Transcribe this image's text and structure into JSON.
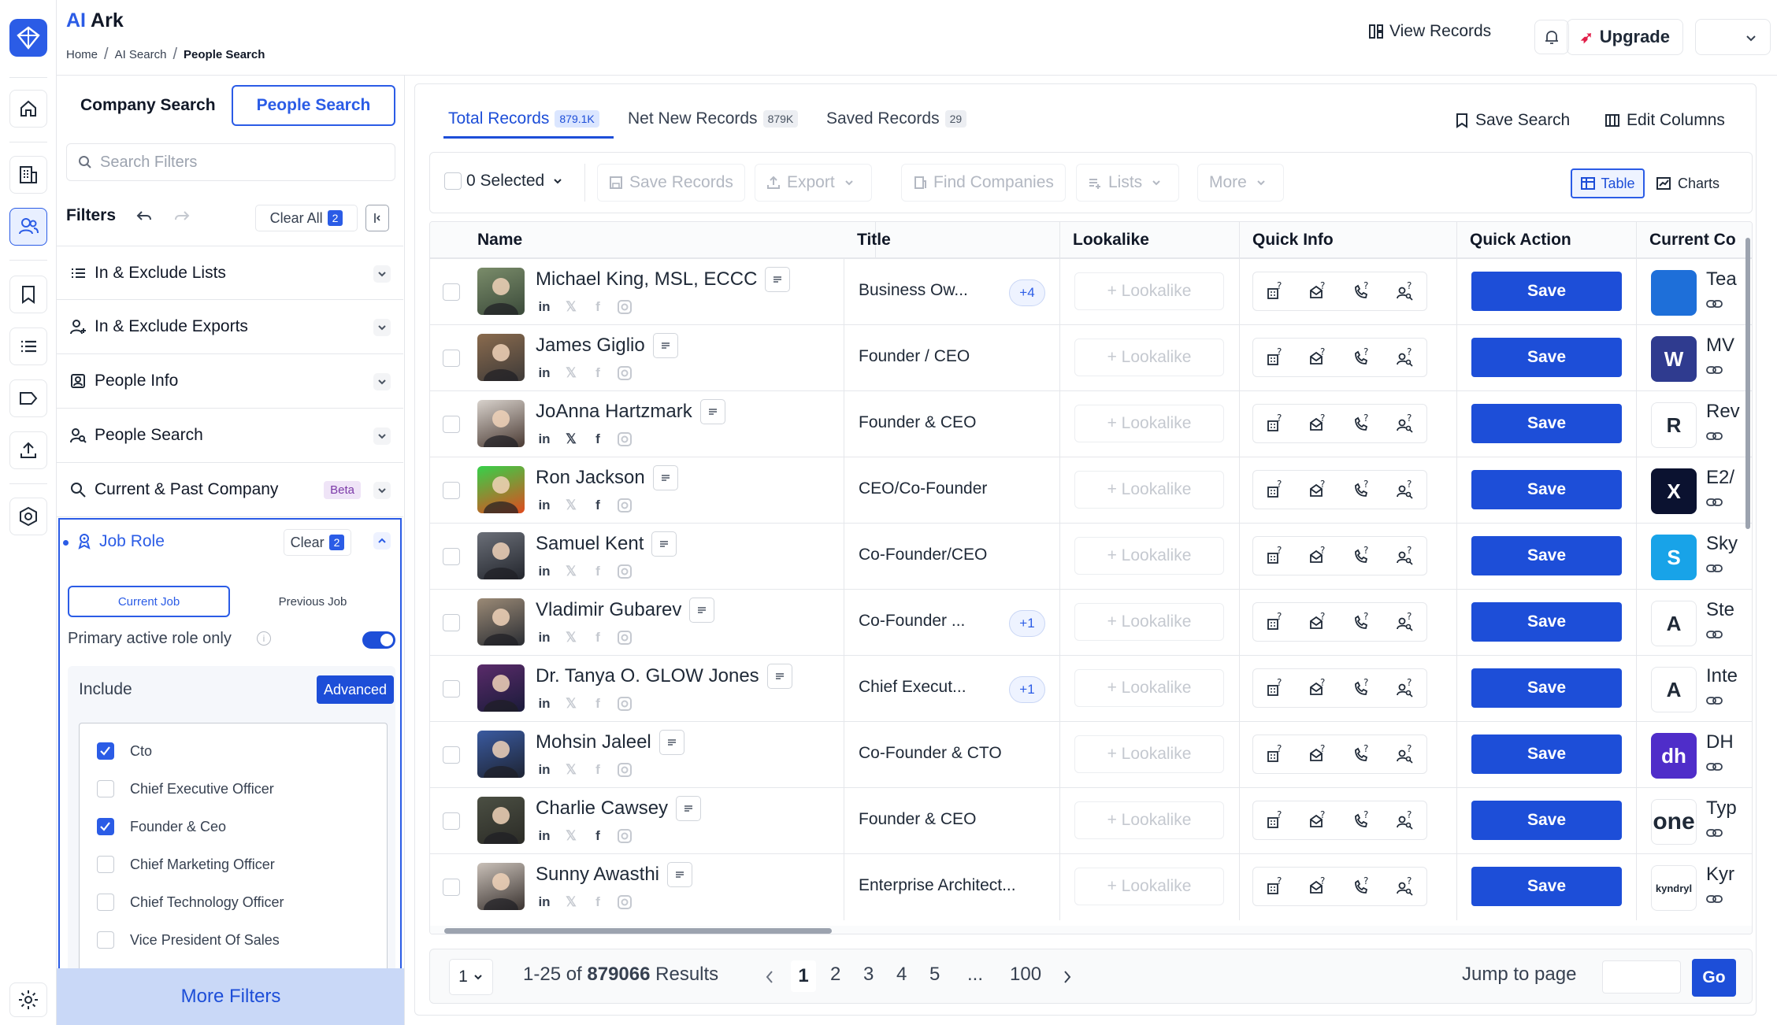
{
  "app": {
    "name_ai": "AI",
    "name_rest": "Ark"
  },
  "breadcrumb": [
    "Home",
    "AI Search",
    "People Search"
  ],
  "header": {
    "view_records": "View Records",
    "upgrade": "Upgrade"
  },
  "search_mode": {
    "company": "Company Search",
    "people": "People Search"
  },
  "filters": {
    "search_placeholder": "Search Filters",
    "title": "Filters",
    "clear_all": "Clear All",
    "clear_all_count": "2",
    "sections": [
      "In & Exclude Lists",
      "In & Exclude Exports",
      "People Info",
      "People Search",
      "Current & Past Company"
    ],
    "beta": "Beta",
    "job_role": {
      "label": "Job Role",
      "clear": "Clear",
      "clear_count": "2",
      "tab_current": "Current Job",
      "tab_previous": "Previous Job",
      "primary_only": "Primary active role only",
      "include": "Include",
      "advanced": "Advanced",
      "options": [
        {
          "label": "Cto",
          "checked": true
        },
        {
          "label": "Chief Executive Officer",
          "checked": false
        },
        {
          "label": "Founder & Ceo",
          "checked": true
        },
        {
          "label": "Chief Marketing Officer",
          "checked": false
        },
        {
          "label": "Chief Technology Officer",
          "checked": false
        },
        {
          "label": "Vice President Of Sales",
          "checked": false
        }
      ]
    },
    "more_filters": "More Filters"
  },
  "tabs": [
    {
      "label": "Total Records",
      "count": "879.1K"
    },
    {
      "label": "Net New Records",
      "count": "879K"
    },
    {
      "label": "Saved Records",
      "count": "29"
    }
  ],
  "actions": {
    "save_search": "Save Search",
    "edit_columns": "Edit Columns"
  },
  "toolbar": {
    "selected": "0 Selected",
    "save_records": "Save Records",
    "export": "Export",
    "find_companies": "Find Companies",
    "lists": "Lists",
    "more": "More",
    "table": "Table",
    "charts": "Charts"
  },
  "columns": [
    "Name",
    "Title",
    "Lookalike",
    "Quick Info",
    "Quick Action",
    "Current Co"
  ],
  "lookalike_label": "+ Lookalike",
  "save_label": "Save",
  "rows": [
    {
      "name": "Michael King, MSL, ECCC",
      "title": "Business Ow...",
      "more": "+4",
      "company": "Tea",
      "x_active": false,
      "fb_active": false,
      "logo_color": "#1e6fd9",
      "logo_text": "",
      "av": [
        "#7a8c6a",
        "#3b4a3a"
      ]
    },
    {
      "name": "James Giglio",
      "title": "Founder / CEO",
      "more": "",
      "company": "MV",
      "x_active": false,
      "fb_active": false,
      "logo_color": "#2f3b8f",
      "logo_text": "W",
      "av": [
        "#8a6b4e",
        "#3e3a38"
      ]
    },
    {
      "name": "JoAnna Hartzmark",
      "title": "Founder & CEO",
      "more": "",
      "company": "Rev",
      "x_active": true,
      "fb_active": true,
      "logo_color": "#ffffff",
      "logo_text": "R",
      "av": [
        "#d8d2cc",
        "#4a3a33"
      ]
    },
    {
      "name": "Ron Jackson",
      "title": "CEO/Co-Founder",
      "more": "",
      "company": "E2/",
      "x_active": false,
      "fb_active": true,
      "logo_color": "#0b1230",
      "logo_text": "X",
      "av": [
        "#36d14a",
        "#e04a1e"
      ]
    },
    {
      "name": "Samuel Kent",
      "title": "Co-Founder/CEO",
      "more": "",
      "company": "Sky",
      "x_active": false,
      "fb_active": false,
      "logo_color": "#18a3e8",
      "logo_text": "S",
      "av": [
        "#6b6f78",
        "#23262d"
      ]
    },
    {
      "name": "Vladimir Gubarev",
      "title": "Co-Founder ...",
      "more": "+1",
      "company": "Ste",
      "x_active": false,
      "fb_active": false,
      "logo_color": "#ffffff",
      "logo_text": "A",
      "av": [
        "#9b8a76",
        "#2a2d33"
      ]
    },
    {
      "name": "Dr. Tanya O. GLOW Jones",
      "title": "Chief Execut...",
      "more": "+1",
      "company": "Inte",
      "x_active": false,
      "fb_active": false,
      "logo_color": "#ffffff",
      "logo_text": "A",
      "av": [
        "#5a2b6a",
        "#1a1b3a"
      ]
    },
    {
      "name": "Mohsin Jaleel",
      "title": "Co-Founder & CTO",
      "more": "",
      "company": "DH",
      "x_active": false,
      "fb_active": false,
      "logo_color": "#4f2dc9",
      "logo_text": "dh",
      "av": [
        "#3a5aa0",
        "#1e2433"
      ]
    },
    {
      "name": "Charlie Cawsey",
      "title": "Founder & CEO",
      "more": "",
      "company": "Typ",
      "x_active": false,
      "fb_active": true,
      "logo_color": "#ffffff",
      "logo_text": "one",
      "av": [
        "#4b4f43",
        "#2b2b26"
      ]
    },
    {
      "name": "Sunny Awasthi",
      "title": "Enterprise Architect...",
      "more": "",
      "company": "Kyr",
      "x_active": false,
      "fb_active": false,
      "logo_color": "#ffffff",
      "logo_text": "kyndryl",
      "av": [
        "#c9c0b8",
        "#3a3330"
      ]
    }
  ],
  "pager": {
    "per_page": "1",
    "range": "1-25 of",
    "total": "879066",
    "results": "Results",
    "pages": [
      "1",
      "2",
      "3",
      "4",
      "5",
      "...",
      "100"
    ],
    "jump": "Jump to page",
    "go": "Go"
  },
  "colors": {
    "accent": "#2b5ce6",
    "save": "#1d4ed8"
  }
}
